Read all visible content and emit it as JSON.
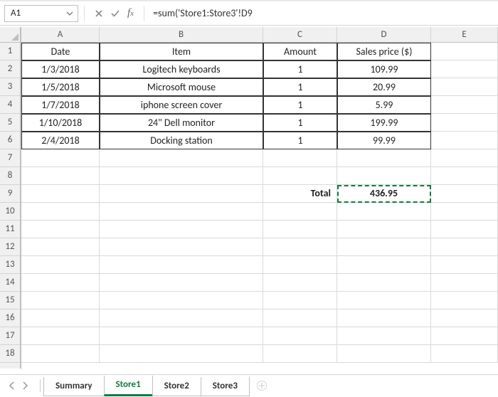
{
  "name_box": "A1",
  "formula": "=sum('Store1:Store3'!D9",
  "columns": [
    "A",
    "B",
    "C",
    "D",
    "E"
  ],
  "rows_shown": 18,
  "headers": {
    "date": "Date",
    "item": "Item",
    "amount": "Amount",
    "price": "Sales price ($)"
  },
  "data_rows": [
    {
      "date": "1/3/2018",
      "item": "Logitech keyboards",
      "amount": "1",
      "price": "109.99"
    },
    {
      "date": "1/5/2018",
      "item": "Microsoft mouse",
      "amount": "1",
      "price": "20.99"
    },
    {
      "date": "1/7/2018",
      "item": "iphone screen cover",
      "amount": "1",
      "price": "5.99"
    },
    {
      "date": "1/10/2018",
      "item": "24\" Dell monitor",
      "amount": "1",
      "price": "199.99"
    },
    {
      "date": "2/4/2018",
      "item": "Docking station",
      "amount": "1",
      "price": "99.99"
    }
  ],
  "total_label": "Total",
  "total_value": "436.95",
  "sheet_tabs": [
    "Summary",
    "Store1",
    "Store2",
    "Store3"
  ],
  "active_tab": "Store1",
  "chart_data": {
    "type": "table",
    "columns": [
      "Date",
      "Item",
      "Amount",
      "Sales price ($)"
    ],
    "rows": [
      [
        "1/3/2018",
        "Logitech keyboards",
        1,
        109.99
      ],
      [
        "1/5/2018",
        "Microsoft mouse",
        1,
        20.99
      ],
      [
        "1/7/2018",
        "iphone screen cover",
        1,
        5.99
      ],
      [
        "1/10/2018",
        "24\" Dell monitor",
        1,
        199.99
      ],
      [
        "2/4/2018",
        "Docking station",
        1,
        99.99
      ]
    ],
    "total": 436.95
  }
}
